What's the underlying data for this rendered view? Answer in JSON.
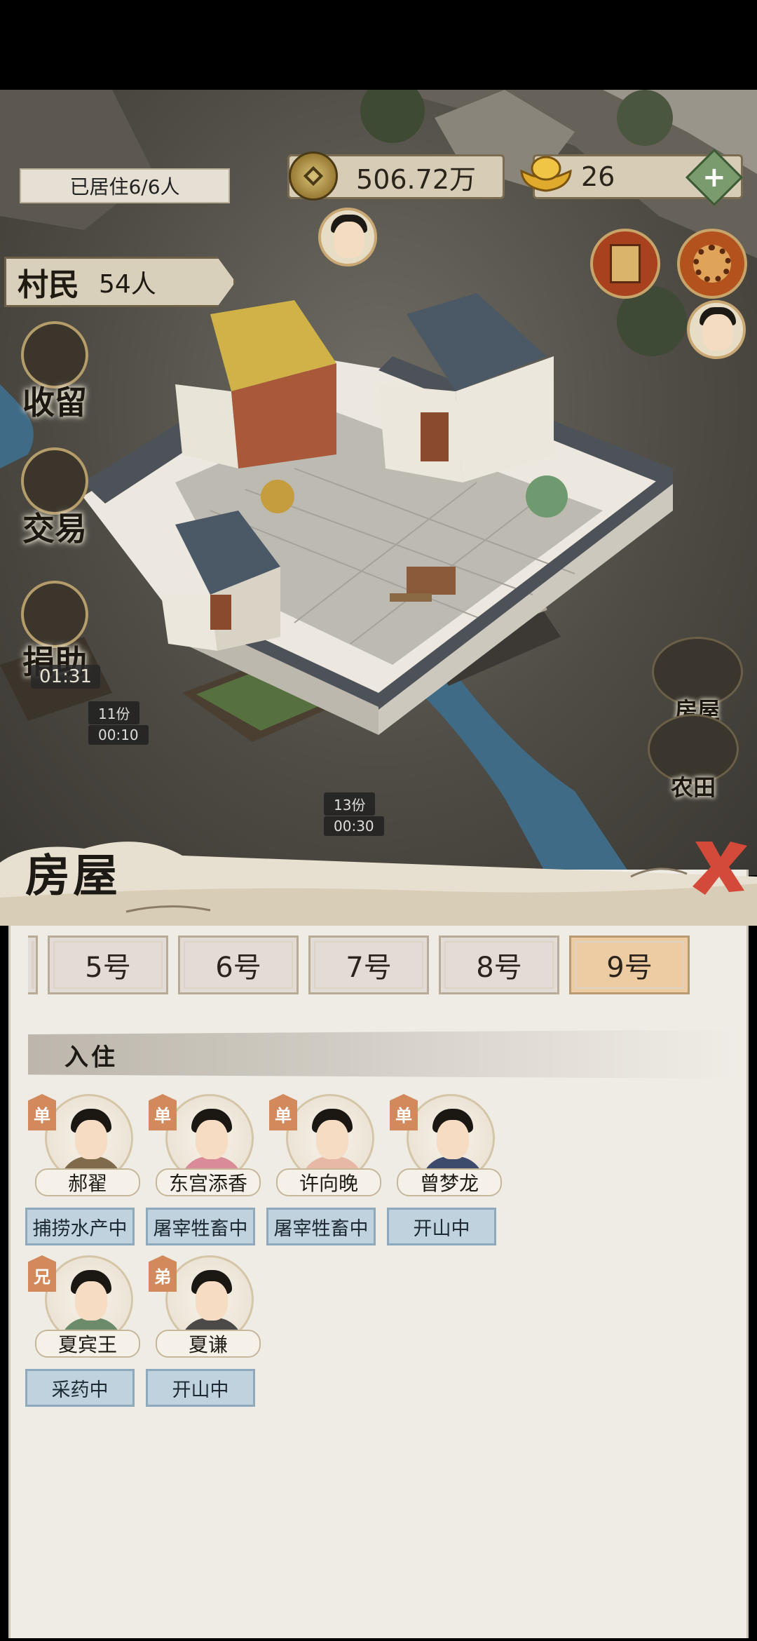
{
  "hud": {
    "resident_status": "已居住6/6人",
    "coins": "506.72万",
    "gold": "26",
    "plus_symbol": "+",
    "villager_label": "村民",
    "villager_count": "54人"
  },
  "side_menu": [
    {
      "label": "收留",
      "icon": "villager-portrait-icon"
    },
    {
      "label": "交易",
      "icon": "trade-icon"
    },
    {
      "label": "捐助",
      "icon": "donate-icon",
      "timer": "01:31"
    }
  ],
  "map_tags": [
    {
      "count": "11份",
      "time": "00:10"
    },
    {
      "count": "13份",
      "time": "00:30"
    }
  ],
  "map_buildings": [
    "房屋",
    "农田"
  ],
  "panel": {
    "title": "房屋",
    "tabs": [
      {
        "label": "",
        "active": false
      },
      {
        "label": "5号",
        "active": false
      },
      {
        "label": "6号",
        "active": false
      },
      {
        "label": "7号",
        "active": false
      },
      {
        "label": "8号",
        "active": false
      },
      {
        "label": "9号",
        "active": true
      }
    ],
    "section_label": "入住",
    "residents": [
      {
        "name": "郝翟",
        "status": "单",
        "job": "捕捞水产中",
        "body_color": "#7f6a4c"
      },
      {
        "name": "东宫添香",
        "status": "单",
        "job": "屠宰牲畜中",
        "body_color": "#d98b9a"
      },
      {
        "name": "许向晚",
        "status": "单",
        "job": "屠宰牲畜中",
        "body_color": "#e7b8a5"
      },
      {
        "name": "曾梦龙",
        "status": "单",
        "job": "开山中",
        "body_color": "#3c4a6b"
      },
      {
        "name": "夏宾王",
        "status": "兄",
        "job": "采药中",
        "body_color": "#6c8b6a"
      },
      {
        "name": "夏谦",
        "status": "弟",
        "job": "开山中",
        "body_color": "#4b4a48"
      }
    ]
  }
}
